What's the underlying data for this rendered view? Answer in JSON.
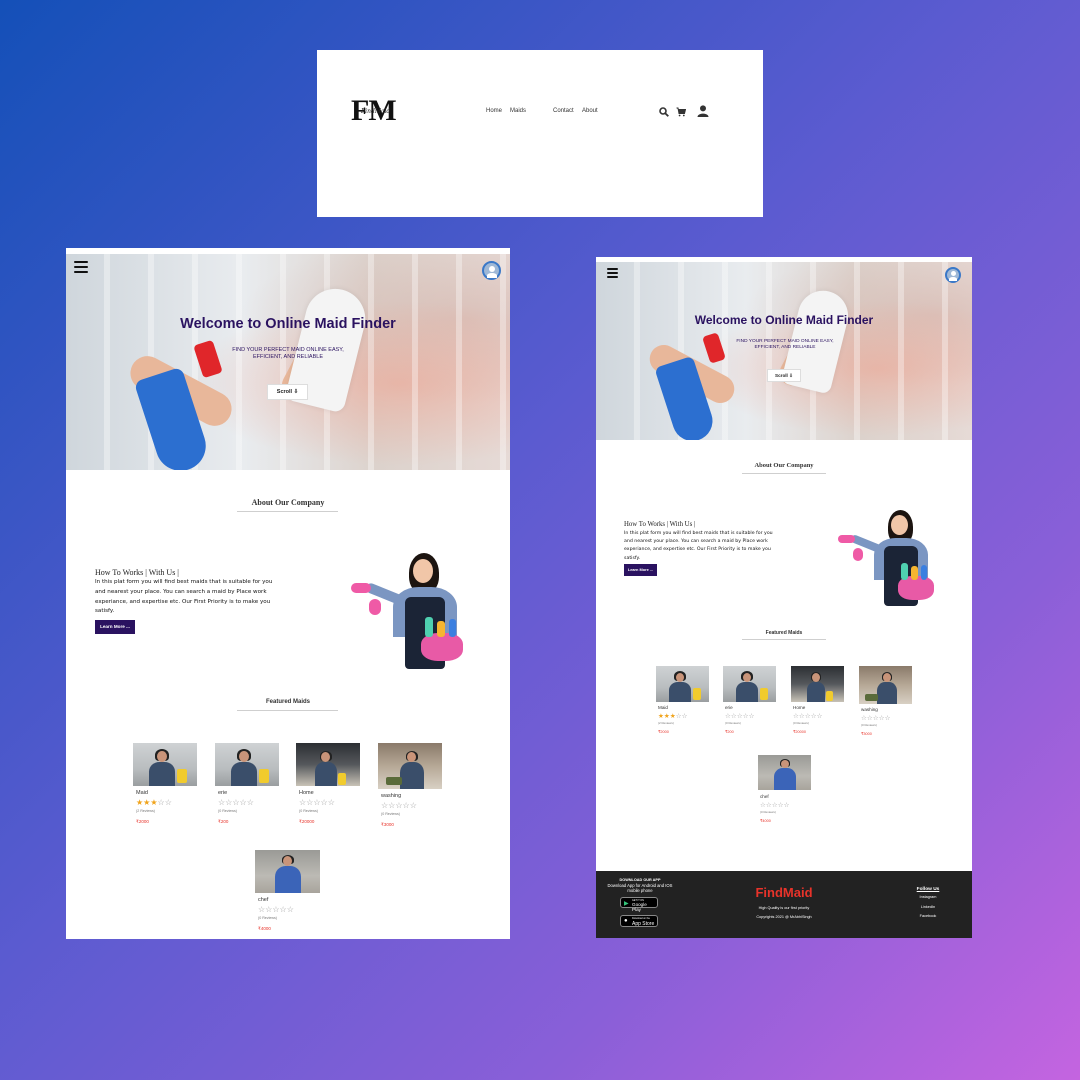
{
  "nav": {
    "logo_letters": "FM",
    "logo_script": "FindMaid",
    "links": [
      "Home",
      "Maids",
      "Contact",
      "About"
    ],
    "icons": [
      "search-icon",
      "cart-icon",
      "user-icon"
    ]
  },
  "hero": {
    "title": "Welcome to Online Maid Finder",
    "subtitle": "FIND YOUR PERFECT MAID ONLINE EASY, EFFICIENT, AND RELIABLE",
    "scroll_button": "Scroll ⇩"
  },
  "about": {
    "title": "About Our Company",
    "subtitle": "How To Works | With Us |",
    "text": "In this plat form you will find best maids that is suitable for you and nearest your place. You can search a maid by Place work experiance, and expertise etc. Our First Priority is to make you satisfy.",
    "learn_more": "Learn More ..."
  },
  "featured": {
    "title": "Featured Maids",
    "maids": [
      {
        "name": "Maid",
        "rating": 3,
        "reviews": "(2 Reviews)",
        "price": "₹2000"
      },
      {
        "name": "erie",
        "rating": 0,
        "reviews": "(0 Reviews)",
        "price": "₹200"
      },
      {
        "name": "Home",
        "rating": 0,
        "reviews": "(0 Reviews)",
        "price": "₹20000"
      },
      {
        "name": "washing",
        "rating": 0,
        "reviews": "(0 Reviews)",
        "price": "₹3000"
      },
      {
        "name": "chef",
        "rating": 0,
        "reviews": "(0 Reviews)",
        "price": "₹4000"
      }
    ]
  },
  "footer": {
    "download_title": "DOWNLOAD OUR APP",
    "download_text": "Download App for Android and IOS mobile phone",
    "google_play_small": "GET IT ON",
    "google_play": "Google Play",
    "app_store_small": "Download on the",
    "app_store": "App Store",
    "brand": "FindMaid",
    "tagline": "High Quality is our first priority",
    "copyright": "Copyrights 2021 @ MrAbhiSingh",
    "follow_title": "Follow Us",
    "social": [
      "Instagram",
      "LinkedIn",
      "Facebook"
    ]
  },
  "colors": {
    "brand_purple": "#2a1260",
    "price_red": "#e8332a",
    "star_gold": "#f0a31a",
    "footer_brand_red": "#e8332a",
    "footer_bg": "#222222"
  }
}
